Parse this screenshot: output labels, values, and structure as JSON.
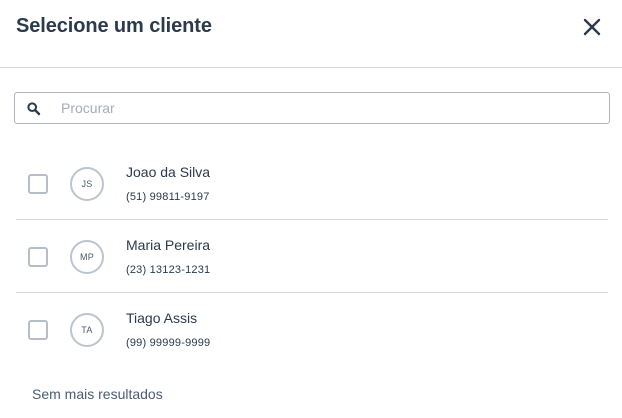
{
  "modal": {
    "title": "Selecione um cliente",
    "close_icon": "close-icon"
  },
  "search": {
    "placeholder": "Procurar",
    "value": "",
    "icon": "search-icon"
  },
  "clients": [
    {
      "initials": "JS",
      "name": "Joao da Silva",
      "phone": "(51) 99811-9197",
      "checked": false
    },
    {
      "initials": "MP",
      "name": "Maria Pereira",
      "phone": "(23) 13123-1231",
      "checked": false
    },
    {
      "initials": "TA",
      "name": "Tiago Assis",
      "phone": "(99) 99999-9999",
      "checked": false
    }
  ],
  "footer": {
    "no_more_results": "Sem mais resultados"
  },
  "colors": {
    "title": "#2b3b4c",
    "border": "#d7dce2",
    "placeholder": "#a4acb4",
    "muted_link": "#4a5d72"
  }
}
